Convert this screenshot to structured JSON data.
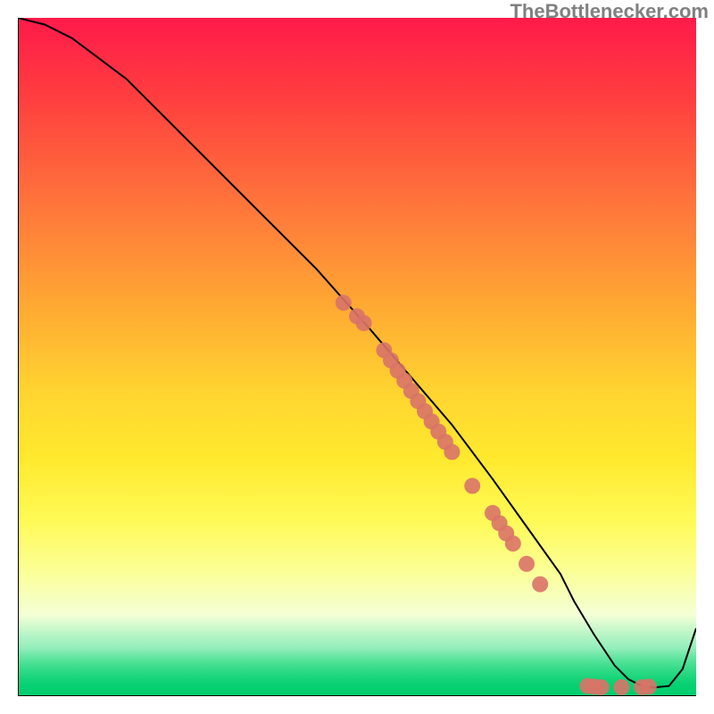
{
  "watermark": "TheBottlenecker.com",
  "colors": {
    "curve": "#000000",
    "dot_fill": "#d97368",
    "gradient_top": "#ff1a4a",
    "gradient_mid": "#ffe92e",
    "gradient_bottom": "#00cf6f",
    "axis": "#000000"
  },
  "chart_data": {
    "type": "line",
    "title": "",
    "xlabel": "",
    "ylabel": "",
    "xlim": [
      0,
      100
    ],
    "ylim": [
      0,
      100
    ],
    "annotations": [],
    "series": [
      {
        "name": "curve",
        "x": [
          0,
          4,
          8,
          12,
          16,
          20,
          28,
          36,
          44,
          52,
          58,
          64,
          70,
          75,
          80,
          82,
          85,
          88,
          90,
          92,
          94,
          96,
          98,
          100
        ],
        "y": [
          100,
          99,
          97,
          94,
          91,
          87,
          79,
          71,
          63,
          54,
          47,
          40,
          32,
          25,
          18,
          14,
          9,
          4.5,
          2.5,
          1.5,
          1.3,
          1.5,
          4,
          10
        ]
      }
    ],
    "points": [
      {
        "name": "p1",
        "x": 48,
        "y": 58
      },
      {
        "name": "p2",
        "x": 50,
        "y": 56
      },
      {
        "name": "p3",
        "x": 51,
        "y": 55
      },
      {
        "name": "p4",
        "x": 54,
        "y": 51
      },
      {
        "name": "p5",
        "x": 55,
        "y": 49.5
      },
      {
        "name": "p6",
        "x": 56,
        "y": 48
      },
      {
        "name": "p7",
        "x": 57,
        "y": 46.5
      },
      {
        "name": "p8",
        "x": 58,
        "y": 45
      },
      {
        "name": "p9",
        "x": 59,
        "y": 43.5
      },
      {
        "name": "p10",
        "x": 60,
        "y": 42
      },
      {
        "name": "p11",
        "x": 61,
        "y": 40.5
      },
      {
        "name": "p12",
        "x": 62,
        "y": 39
      },
      {
        "name": "p13",
        "x": 63,
        "y": 37.5
      },
      {
        "name": "p14",
        "x": 64,
        "y": 36
      },
      {
        "name": "p15",
        "x": 67,
        "y": 31
      },
      {
        "name": "p16",
        "x": 70,
        "y": 27
      },
      {
        "name": "p17",
        "x": 71,
        "y": 25.5
      },
      {
        "name": "p18",
        "x": 72,
        "y": 24
      },
      {
        "name": "p19",
        "x": 73,
        "y": 22.5
      },
      {
        "name": "p20",
        "x": 75,
        "y": 19.5
      },
      {
        "name": "p21",
        "x": 77,
        "y": 16.5
      },
      {
        "name": "p22",
        "x": 84,
        "y": 1.5
      },
      {
        "name": "p23",
        "x": 85,
        "y": 1.4
      },
      {
        "name": "p24",
        "x": 86,
        "y": 1.3
      },
      {
        "name": "p25",
        "x": 89,
        "y": 1.3
      },
      {
        "name": "p26",
        "x": 92,
        "y": 1.3
      },
      {
        "name": "p27",
        "x": 93,
        "y": 1.4
      }
    ]
  }
}
